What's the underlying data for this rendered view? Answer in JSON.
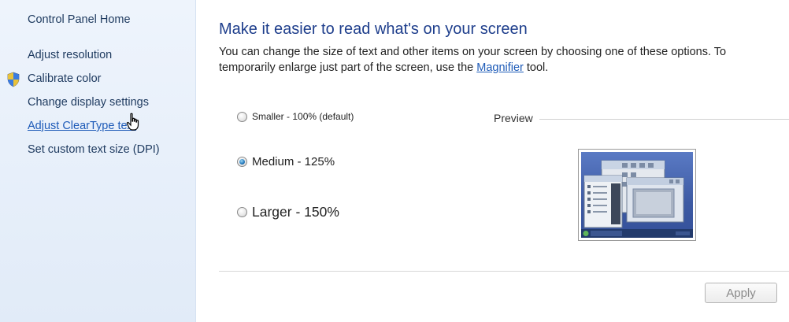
{
  "sidebar": {
    "home": "Control Panel Home",
    "items": [
      {
        "label": "Adjust resolution"
      },
      {
        "label": "Calibrate color"
      },
      {
        "label": "Change display settings"
      },
      {
        "label": "Adjust ClearType text"
      },
      {
        "label": "Set custom text size (DPI)"
      }
    ]
  },
  "main": {
    "title": "Make it easier to read what's on your screen",
    "description_part1": "You can change the size of text and other items on your screen by choosing one of these options. To temporarily enlarge just part of the screen, use the ",
    "magnifier_link": "Magnifier",
    "description_part2": " tool.",
    "options": [
      {
        "label": "Smaller - 100% (default)",
        "checked": false
      },
      {
        "label": "Medium - 125%",
        "checked": true
      },
      {
        "label": "Larger - 150%",
        "checked": false
      }
    ],
    "preview_label": "Preview",
    "apply_label": "Apply"
  },
  "colors": {
    "title": "#1e3e8c",
    "link": "#1e5bb8",
    "sidebar_bg": "#e8f0fb"
  },
  "icons": {
    "shield": "uac-shield-icon",
    "cursor": "hand-cursor-icon"
  }
}
